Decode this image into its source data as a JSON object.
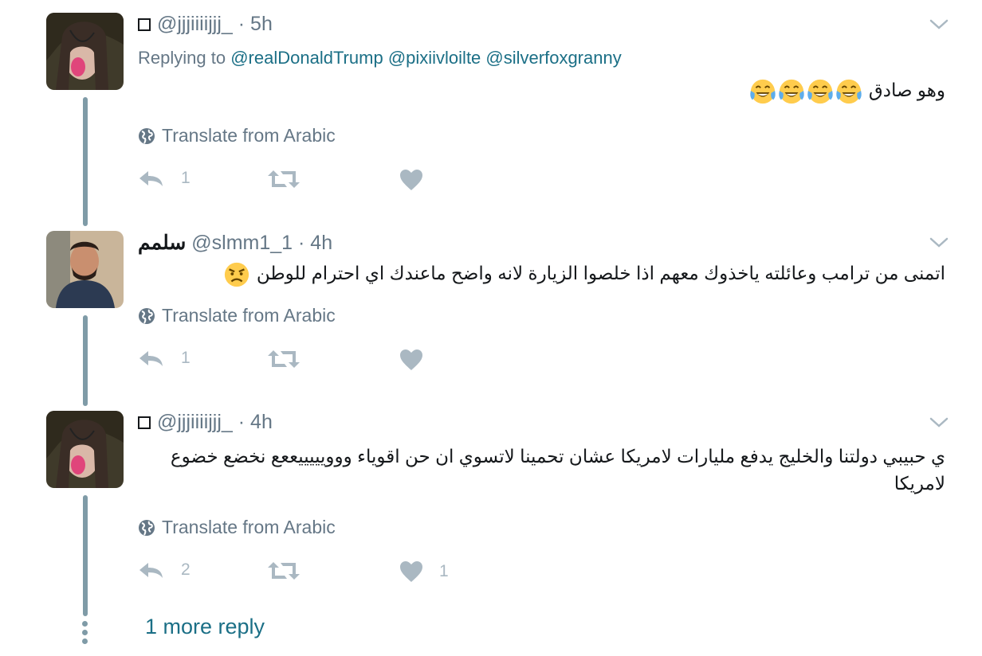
{
  "tweets": [
    {
      "display_name": "",
      "handle": "@jjjiiiijjj_",
      "time": "· 5h",
      "replying_prefix": "Replying to",
      "replying_to": [
        "@realDonaldTrump",
        "@pixiivloilte",
        "@silverfoxgranny"
      ],
      "text": "وهو صادق",
      "emoji": [
        "face-with-tears-of-joy",
        "face-with-tears-of-joy",
        "face-with-tears-of-joy",
        "face-with-tears-of-joy"
      ],
      "translate": "Translate from Arabic",
      "reply_count": "1",
      "retweet_count": "",
      "like_count": ""
    },
    {
      "display_name": "سلمم",
      "handle": "@slmm1_1",
      "time": "· 4h",
      "text": "اتمنى من ترامب وعائلته ياخذوك معهم اذا خلصوا الزيارة لانه واضح ماعندك اي احترام للوطن",
      "emoji": [
        "angry-face"
      ],
      "translate": "Translate from Arabic",
      "reply_count": "1",
      "retweet_count": "",
      "like_count": ""
    },
    {
      "display_name": "",
      "handle": "@jjjiiiijjj_",
      "time": "· 4h",
      "text": "ي حبيبي دولتنا والخليج يدفع مليارات لامريكا عشان تحمينا لاتسوي ان حن اقوياء ووويييييععع نخضع خضوع لامريكا",
      "translate": "Translate from Arabic",
      "reply_count": "2",
      "retweet_count": "",
      "like_count": "1"
    }
  ],
  "more_replies": "1 more reply",
  "colors": {
    "link": "#1b6f86",
    "muted": "#657786",
    "thread": "#7f9ba7",
    "icon": "#aab8c2"
  },
  "icons": [
    "reply-icon",
    "retweet-icon",
    "heart-icon",
    "globe-icon",
    "chevron-down-icon"
  ]
}
